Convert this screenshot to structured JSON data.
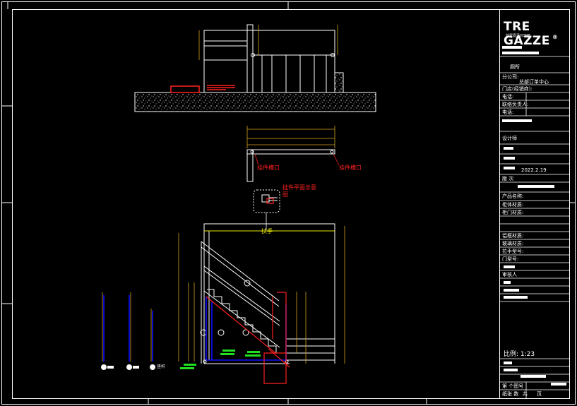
{
  "title_block": {
    "brand": "TRE GAZZE",
    "brand_mark": "®",
    "brand_sub": "莎翠嘉泽HOME",
    "space_name": "厕所",
    "company_label": "分公司:",
    "company_value": "总部订单中心",
    "store_label": "门店(经销商):",
    "tel_label_1": "电话:",
    "contact_label": "联络负责人:",
    "tel_label_2": "电话:",
    "designer_label": "设计师",
    "date_value": "2022.2.19",
    "version_label": "版  次",
    "product_label": "产品名称:",
    "cabinet_label": "柜体材质:",
    "door_label": "柜门材质:",
    "frame_label": "铝框材质:",
    "glass_label": "玻璃材质:",
    "handle_label": "拉手型号:",
    "door_type_label": "门型号:",
    "reviewer_label": "审核人",
    "scale_label": "比例: 1:23",
    "sheet_label": "第 个图号",
    "page_label": "纸张 数",
    "page_box_label": "共",
    "page_count": "页"
  },
  "drawing": {
    "annotation_slot_left": "挂件槽口",
    "annotation_slot_right": "挂件槽口",
    "annotation_plan": "挂件平面示意图",
    "annotation_handrail": "扶手",
    "post_legend_3": "竖杆"
  },
  "colors": {
    "frame": "#ffffff",
    "outline": "#ffffff",
    "dimension": "#d4a020",
    "annotation": "#ff2020",
    "handrail": "#e8e800",
    "post": "#1010ff",
    "tag": "#20e020"
  }
}
